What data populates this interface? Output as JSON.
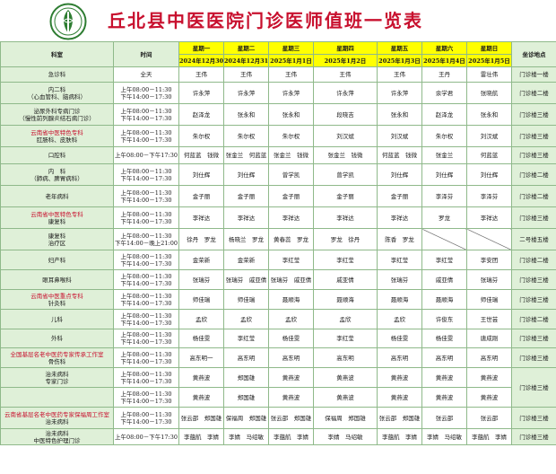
{
  "title": "丘北县中医医院门诊医师值班一览表",
  "colors": {
    "title": "#c8102e",
    "day_header": "#ffff00",
    "dept_bg": "#dff0d8",
    "border": "#8fb98a"
  },
  "header": {
    "dept": "科室",
    "time": "时间",
    "location": "坐诊地点",
    "days": [
      {
        "name": "星期一",
        "date": "2024年12月30日"
      },
      {
        "name": "星期二",
        "date": "2024年12月31日"
      },
      {
        "name": "星期三",
        "date": "2025年1月1日"
      },
      {
        "name": "星期四",
        "date": "2025年1月2日"
      },
      {
        "name": "星期五",
        "date": "2025年1月3日"
      },
      {
        "name": "星期六",
        "date": "2025年1月4日"
      },
      {
        "name": "星期日",
        "date": "2025年1月5日"
      }
    ]
  },
  "rows": [
    {
      "dept": [
        "急诊科"
      ],
      "time": [
        "全天"
      ],
      "cells": [
        "王伟",
        "王伟",
        "王伟",
        "王伟",
        "王伟",
        "王丹",
        "雷壮伟"
      ],
      "location": "门诊楼一楼"
    },
    {
      "dept": [
        "内二科",
        "（心血管科、脑病科）"
      ],
      "time": [
        "上午08:00－11:30",
        "下午14:00－17:30"
      ],
      "cells": [
        "许永萍",
        "许永萍",
        "许永萍",
        "许永萍",
        "许永萍",
        "余学君",
        "张晓航"
      ],
      "location": "门诊楼二楼"
    },
    {
      "dept": [
        "泌尿外科专病门诊",
        "（慢性前列腺炎结石病门诊）"
      ],
      "time": [
        "上午08:00－11:30",
        "下午14:00－17:30"
      ],
      "cells": [
        "赵泽龙",
        "张永和",
        "张永和",
        "段晓吉",
        "张永和",
        "赵泽龙",
        "张永和"
      ],
      "location": "门诊楼三楼"
    },
    {
      "dept": [
        "云南省中医特色专科",
        "肛肠科、皮肤科"
      ],
      "time": [
        "上午08:00－11:30",
        "下午14:00－17:30"
      ],
      "cells": [
        "朱尔权",
        "朱尔权",
        "朱尔权",
        "刘汉斌",
        "刘汉斌",
        "朱尔权",
        "刘汉斌"
      ],
      "location": "门诊楼三楼",
      "red_line": 0
    },
    {
      "dept": [
        "口腔科"
      ],
      "time": [
        "上午08:00－下午17:30"
      ],
      "cells": [
        "何蓝蓝　钱微",
        "张金兰　何蓝蓝",
        "张金兰　钱微",
        "张金兰　钱微",
        "何蓝蓝　钱微",
        "张金兰",
        "何蓝蓝"
      ],
      "location": "门诊楼三楼"
    },
    {
      "dept": [
        "内　科",
        "（肺病、脾胃病科）"
      ],
      "time": [
        "上午08:00－11:30",
        "下午14:00－17:30"
      ],
      "cells": [
        "刘仕辉",
        "刘仕辉",
        "曾学凯",
        "曾学凯",
        "刘仕辉",
        "刘仕辉",
        "刘仕辉"
      ],
      "location": "门诊楼二楼"
    },
    {
      "dept": [
        "老年病科"
      ],
      "time": [
        "上午08:00－11:30",
        "下午14:00－17:30"
      ],
      "cells": [
        "金子丽",
        "金子丽",
        "金子丽",
        "金子丽",
        "金子丽",
        "李泽芬",
        "李泽芬"
      ],
      "location": "门诊楼二楼"
    },
    {
      "dept": [
        "云南省中医特色专科",
        "康复科"
      ],
      "time": [
        "上午08:00－11:30",
        "下午14:00－17:30"
      ],
      "cells": [
        "李祥达",
        "李祥达",
        "李祥达",
        "李祥达",
        "李祥达",
        "罗龙",
        "李祥达"
      ],
      "location": "门诊楼三楼",
      "red_line": 0
    },
    {
      "dept": [
        "康复科",
        "治疗区"
      ],
      "time": [
        "上午08:00－11:30",
        "下午14:00－晚上21:00"
      ],
      "cells": [
        "徐丹　罗龙",
        "杨晓兰　罗龙",
        "黄春蕊　罗龙",
        "罗龙　徐丹",
        "陈香　罗龙",
        "/",
        "/"
      ],
      "location": "二号楼五楼"
    },
    {
      "dept": [
        "妇产科"
      ],
      "time": [
        "上午08:00－11:30",
        "下午14:00－17:30"
      ],
      "cells": [
        "金荣新",
        "金荣新",
        "李红莹",
        "李红莹",
        "李红莹",
        "李红莹",
        "李安团"
      ],
      "location": "门诊楼二楼"
    },
    {
      "dept": [
        "眼耳鼻喉科"
      ],
      "time": [
        "上午08:00－11:30",
        "下午14:00－17:30"
      ],
      "cells": [
        "张瑞芬",
        "张瑞芬　戚亚倩",
        "张瑞芬　戚亚倩",
        "戚亚倩",
        "张瑞芬",
        "戚亚倩",
        "张瑞芬"
      ],
      "location": "门诊楼三楼"
    },
    {
      "dept": [
        "云南省中医重点专科",
        "针灸科"
      ],
      "time": [
        "上午08:00－11:30",
        "下午14:00－17:30"
      ],
      "cells": [
        "师佳瑞",
        "师佳瑞",
        "聂顺海",
        "聂顺海",
        "聂顺海",
        "聂顺海",
        "师佳瑞"
      ],
      "location": "门诊楼三楼",
      "red_line": 0
    },
    {
      "dept": [
        "儿科"
      ],
      "time": [
        "上午08:00－11:30",
        "下午14:00－17:30"
      ],
      "cells": [
        "孟欣",
        "孟欣",
        "孟欣",
        "孟欣",
        "孟欣",
        "许俊东",
        "王世芸"
      ],
      "location": "门诊楼二楼"
    },
    {
      "dept": [
        "外科"
      ],
      "time": [
        "上午08:00－11:30",
        "下午14:00－17:30"
      ],
      "cells": [
        "杨佳雯",
        "李红莹",
        "杨佳雯",
        "李红莹",
        "杨佳雯",
        "杨佳雯",
        "唐成刚"
      ],
      "location": "门诊楼三楼"
    },
    {
      "dept": [
        "全国基层名老中医药专家传承工作室",
        "骨伤科"
      ],
      "time": [
        "上午08:00－11:30",
        "下午14:00－17:30"
      ],
      "cells": [
        "高东明一",
        "高东明",
        "高东明",
        "高东明",
        "高东明",
        "高东明",
        "高东明"
      ],
      "location": "门诊楼三楼",
      "red_line": 0
    },
    {
      "dept": [
        "治未病科",
        "专家门诊"
      ],
      "time": [
        "上午08:00－11:30",
        "下午14:00－17:30"
      ],
      "cells": [
        "黄燕波",
        "郑国雄",
        "黄燕波",
        "黄燕波",
        "黄燕波",
        "黄燕波",
        "黄燕波"
      ],
      "location": "门诊楼三楼",
      "loc_span": 2
    },
    {
      "dept": [
        ""
      ],
      "time": [
        "上午08:00－11:30",
        "下午14:00－17:30"
      ],
      "cells": [
        "黄燕波",
        "郑国雄",
        "黄燕波",
        "黄燕波",
        "黄燕波",
        "黄燕波",
        "黄燕波"
      ],
      "location": ""
    },
    {
      "dept": [
        "云南省基层名老中医药专家保福周工作室",
        "治未病科"
      ],
      "time": [
        "上午08:00－11:30",
        "下午14:00－17:30"
      ],
      "cells": [
        "张云邵　郑国雄",
        "保福周　郑国雄",
        "张云邵　郑国雄",
        "保福周　郑国雄",
        "张云邵　郑国雄",
        "张云邵",
        "张云邵"
      ],
      "location": "门诊楼三楼",
      "red_line": 0
    },
    {
      "dept": [
        "治未病科",
        "中医特色护理门诊"
      ],
      "time": [
        "上午08:00－下午17:30"
      ],
      "cells": [
        "李蕴航　李婧",
        "李婧　马绍敏",
        "李蕴航　李婧",
        "李婧　马绍敏",
        "李蕴航　李婧",
        "李婧　马绍敏",
        "李蕴航　李婧"
      ],
      "location": "门诊楼三楼"
    }
  ]
}
